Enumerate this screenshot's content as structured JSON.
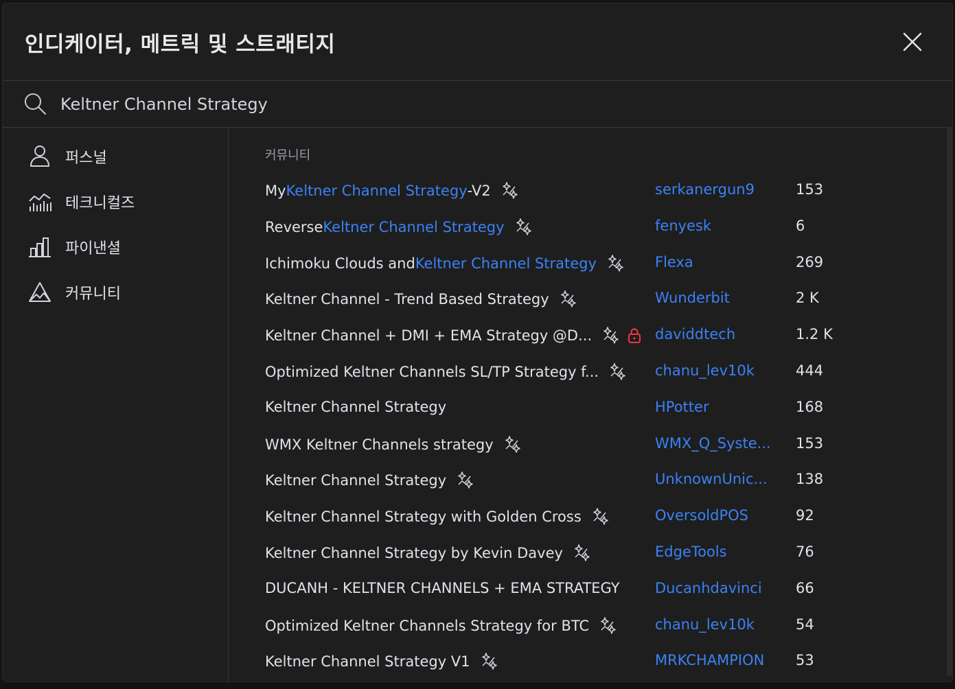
{
  "dialog": {
    "title": "인디케이터, 메트릭 및 스트래티지"
  },
  "search": {
    "value": "Keltner Channel Strategy",
    "placeholder": "검색"
  },
  "sidebar": {
    "items": [
      {
        "label": "퍼스널",
        "icon": "user-icon"
      },
      {
        "label": "테크니컬즈",
        "icon": "technicals-icon"
      },
      {
        "label": "파이낸셜",
        "icon": "bar-chart-icon"
      },
      {
        "label": "커뮤니티",
        "icon": "community-icon"
      }
    ]
  },
  "main": {
    "section_title": "커뮤니티",
    "rows": [
      {
        "pre": "My ",
        "hl": "Keltner Channel Strategy",
        "post": "-V2",
        "strategy": true,
        "locked": false,
        "author": "serkanergun9",
        "count": "153"
      },
      {
        "pre": "Reverse ",
        "hl": "Keltner Channel Strategy",
        "post": "",
        "strategy": true,
        "locked": false,
        "author": "fenyesk",
        "count": "6"
      },
      {
        "pre": "Ichimoku Clouds and ",
        "hl": "Keltner Channel Strategy",
        "post": "",
        "strategy": true,
        "locked": false,
        "author": "Flexa",
        "count": "269"
      },
      {
        "pre": "Keltner Channel - Trend Based Strategy",
        "hl": "",
        "post": "",
        "strategy": true,
        "locked": false,
        "author": "Wunderbit",
        "count": "2 K"
      },
      {
        "pre": "Keltner Channel + DMI + EMA Strategy @D...",
        "hl": "",
        "post": "",
        "strategy": true,
        "locked": true,
        "author": "daviddtech",
        "count": "1.2 K"
      },
      {
        "pre": "Optimized Keltner Channels SL/TP Strategy f...",
        "hl": "",
        "post": "",
        "strategy": true,
        "locked": false,
        "author": "chanu_lev10k",
        "count": "444"
      },
      {
        "pre": "Keltner Channel Strategy",
        "hl": "",
        "post": "",
        "strategy": false,
        "locked": false,
        "author": "HPotter",
        "count": "168"
      },
      {
        "pre": "WMX Keltner Channels strategy",
        "hl": "",
        "post": "",
        "strategy": true,
        "locked": false,
        "author": "WMX_Q_Syste...",
        "count": "153"
      },
      {
        "pre": "Keltner Channel Strategy",
        "hl": "",
        "post": "",
        "strategy": true,
        "locked": false,
        "author": "UnknownUnic...",
        "count": "138"
      },
      {
        "pre": "Keltner Channel Strategy with Golden Cross",
        "hl": "",
        "post": "",
        "strategy": true,
        "locked": false,
        "author": "OversoldPOS",
        "count": "92"
      },
      {
        "pre": "Keltner Channel Strategy by Kevin Davey",
        "hl": "",
        "post": "",
        "strategy": true,
        "locked": false,
        "author": "EdgeTools",
        "count": "76"
      },
      {
        "pre": "DUCANH - KELTNER CHANNELS + EMA STRATEGY",
        "hl": "",
        "post": "",
        "strategy": false,
        "locked": false,
        "author": "Ducanhdavinci",
        "count": "66"
      },
      {
        "pre": "Optimized Keltner Channels Strategy for BTC",
        "hl": "",
        "post": "",
        "strategy": true,
        "locked": false,
        "author": "chanu_lev10k",
        "count": "54"
      },
      {
        "pre": "Keltner Channel Strategy V1",
        "hl": "",
        "post": "",
        "strategy": true,
        "locked": false,
        "author": "MRKCHAMPION",
        "count": "53"
      }
    ]
  },
  "colors": {
    "background": "#1e1e1e",
    "text": "#e0e3eb",
    "accent": "#3b82f6",
    "muted": "#9a9ea8",
    "lock": "#f23645"
  }
}
